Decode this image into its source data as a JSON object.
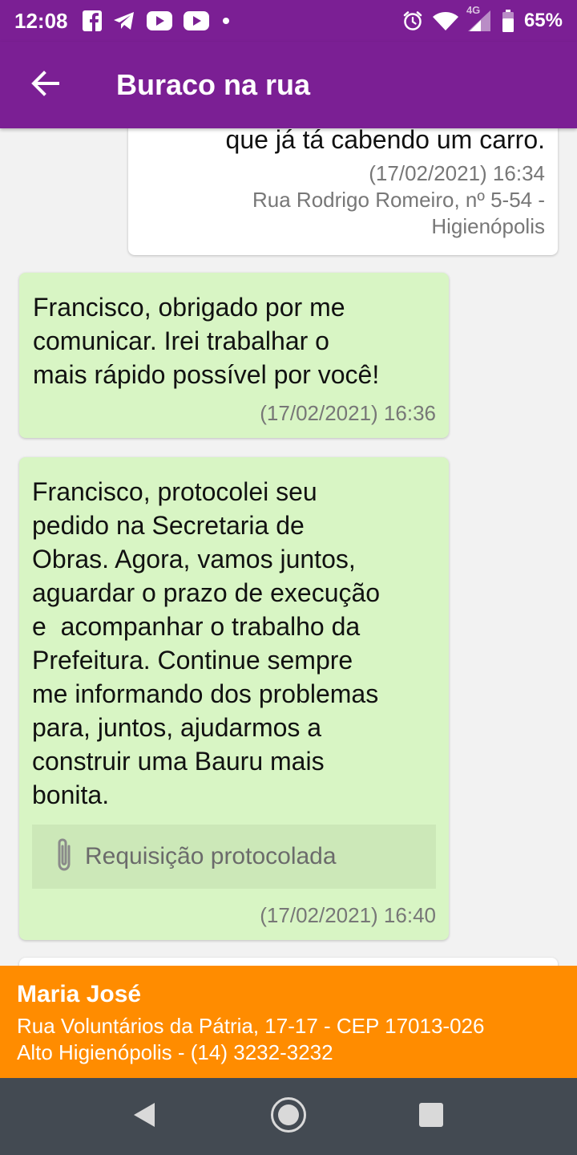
{
  "status_bar": {
    "time": "12:08",
    "network": "4G",
    "battery": "65%",
    "left_icons": [
      "facebook-icon",
      "telegram-icon",
      "youtube-icon",
      "youtube-icon",
      "dot-icon"
    ],
    "right_icons": [
      "alarm-icon",
      "wifi-icon",
      "signal-icon",
      "battery-icon"
    ]
  },
  "app_bar": {
    "title": "Buraco na rua",
    "back_icon": "arrow-left-icon"
  },
  "messages": [
    {
      "type": "outgoing",
      "text": "que já tá cabendo um carro.",
      "timestamp": "(17/02/2021) 16:34",
      "location_line1": "Rua Rodrigo Romeiro, nº 5-54 -",
      "location_line2": "Higienópolis"
    },
    {
      "type": "incoming",
      "text": "Francisco, obrigado por me\ncomunicar. Irei trabalhar o\nmais rápido possível por você!",
      "timestamp": "(17/02/2021) 16:36"
    },
    {
      "type": "incoming",
      "text": "Francisco, protocolei seu\npedido na Secretaria de\nObras. Agora, vamos juntos,\naguardar o prazo de execução\ne  acompanhar o trabalho da\nPrefeitura. Continue sempre\nme informando dos problemas\npara, juntos, ajudarmos a\nconstruir uma Bauru mais\nbonita.",
      "attachment_label": "Requisição protocolada",
      "attachment_icon": "paperclip-icon",
      "timestamp": "(17/02/2021) 16:40"
    }
  ],
  "contact": {
    "name": "Maria José",
    "address_line1": "Rua Voluntários da Pátria, 17-17 - CEP 17013-026",
    "address_line2": "Alto Higienópolis - (14) 3232-3232"
  },
  "nav_bar": {
    "buttons": [
      "back-triangle-icon",
      "home-circle-icon",
      "recents-square-icon"
    ]
  },
  "colors": {
    "primary": "#7b1f94",
    "incoming_bubble": "#d8f5c4",
    "outgoing_bubble": "#ffffff",
    "contact_bar": "#ff8c00",
    "nav_bar": "#434a52"
  }
}
